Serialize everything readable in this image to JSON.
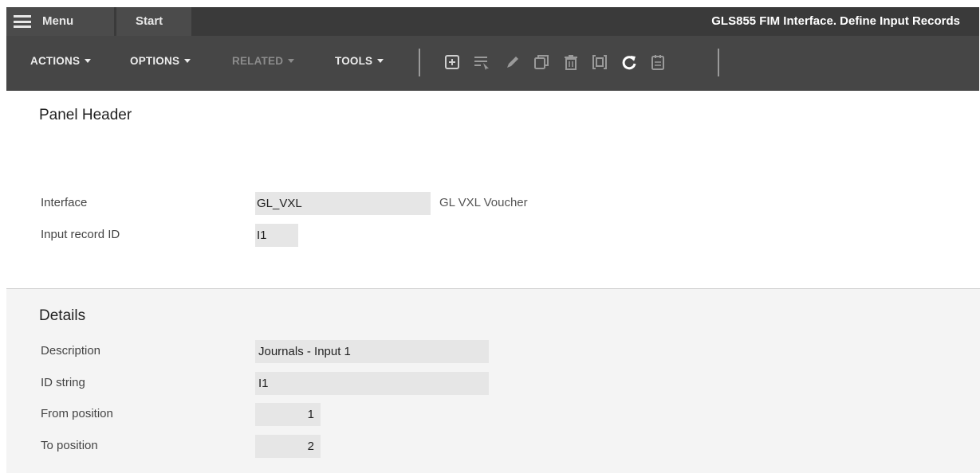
{
  "topbar": {
    "menu_label": "Menu",
    "start_label": "Start",
    "title": "GLS855 FIM Interface. Define Input Records"
  },
  "toolbar": {
    "actions_label": "ACTIONS",
    "options_label": "OPTIONS",
    "related_label": "RELATED",
    "tools_label": "TOOLS",
    "icons": [
      "add-icon",
      "select-list-icon",
      "edit-icon",
      "copy-icon",
      "delete-icon",
      "display-icon",
      "refresh-icon",
      "notes-icon"
    ]
  },
  "panel_header": {
    "title": "Panel Header",
    "interface_label": "Interface",
    "interface_value": "GL_VXL",
    "interface_desc": "GL VXL Voucher",
    "input_record_label": "Input record ID",
    "input_record_value": "I1"
  },
  "details": {
    "title": "Details",
    "description_label": "Description",
    "description_value": "Journals - Input 1",
    "id_string_label": "ID string",
    "id_string_value": "I1",
    "from_position_label": "From position",
    "from_position_value": "1",
    "to_position_label": "To position",
    "to_position_value": "2"
  },
  "colors": {
    "topbar": "#3a3a3a",
    "toolbar": "#464646",
    "field_bg": "#e6e6e6",
    "details_bg": "#f4f4f4"
  }
}
